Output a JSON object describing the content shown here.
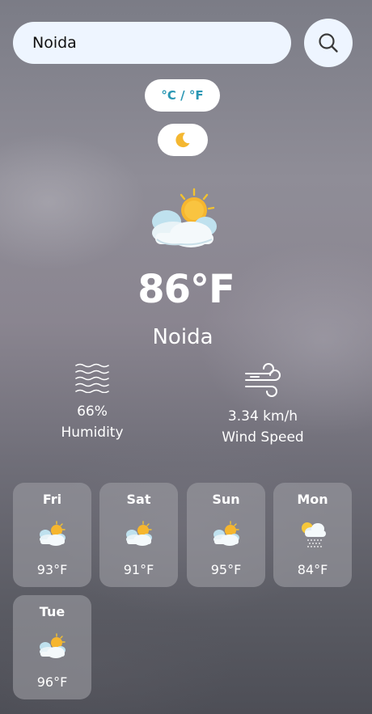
{
  "search": {
    "value": "Noida"
  },
  "controls": {
    "unit_toggle_label": "°C / °F"
  },
  "current": {
    "temperature": "86°F",
    "city": "Noida",
    "condition_icon": "sun-behind-cloud-icon",
    "humidity_value": "66%",
    "humidity_label": "Humidity",
    "wind_value": "3.34 km/h",
    "wind_label": "Wind Speed"
  },
  "forecast": [
    {
      "day": "Fri",
      "temp": "93°F",
      "icon": "sun-behind-cloud-icon"
    },
    {
      "day": "Sat",
      "temp": "91°F",
      "icon": "sun-behind-cloud-icon"
    },
    {
      "day": "Sun",
      "temp": "95°F",
      "icon": "sun-behind-cloud-icon"
    },
    {
      "day": "Mon",
      "temp": "84°F",
      "icon": "sun-cloud-rain-icon"
    },
    {
      "day": "Tue",
      "temp": "96°F",
      "icon": "sun-behind-cloud-icon"
    }
  ],
  "colors": {
    "input_bg": "#eef5ff",
    "accent": "#2a97b4",
    "card_bg": "rgba(155,155,162,0.62)"
  }
}
